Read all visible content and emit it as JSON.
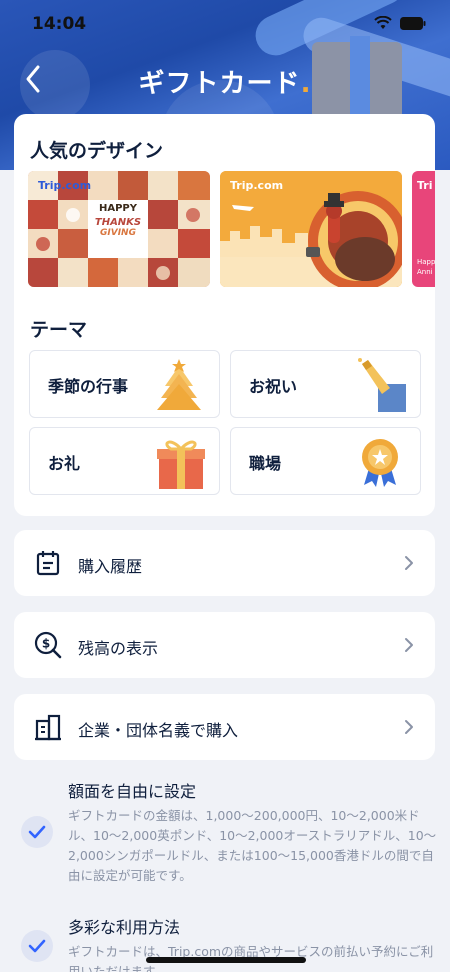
{
  "status_bar": {
    "time": "14:04"
  },
  "header": {
    "title": "ギフトカード"
  },
  "popular": {
    "title": "人気のデザイン",
    "cards": [
      {
        "brand": "Trip.com",
        "headline": "HAPPY",
        "sub1": "THANKS",
        "sub2": "GIVING"
      },
      {
        "brand": "Trip.com"
      },
      {
        "brand": "Tri",
        "line1": "Happ",
        "line2": "Anni"
      }
    ]
  },
  "themes": {
    "title": "テーマ",
    "items": [
      {
        "label": "季節の行事",
        "icon": "tree-icon"
      },
      {
        "label": "お祝い",
        "icon": "champagne-icon"
      },
      {
        "label": "お礼",
        "icon": "gift-icon"
      },
      {
        "label": "職場",
        "icon": "medal-icon"
      }
    ]
  },
  "menu": [
    {
      "label": "購入履歴",
      "icon": "calendar-icon"
    },
    {
      "label": "残高の表示",
      "icon": "balance-search-icon"
    },
    {
      "label": "企業・団体名義で購入",
      "icon": "building-icon"
    }
  ],
  "features": [
    {
      "title": "額面を自由に設定",
      "desc": "ギフトカードの金額は、1,000〜200,000円、10〜2,000米ドル、10〜2,000英ポンド、10〜2,000オーストラリアドル、10〜2,000シンガポールドル、または100〜15,000香港ドルの間で自由に設定が可能です。"
    },
    {
      "title": "多彩な利用方法",
      "desc": "ギフトカードは、Trip.comの商品やサービスの前払い予約にご利用いただけます。"
    }
  ],
  "colors": {
    "accent": "#3264ff",
    "text": "#0f1f3d",
    "muted": "#8a93a6",
    "orange": "#f0a93a"
  }
}
